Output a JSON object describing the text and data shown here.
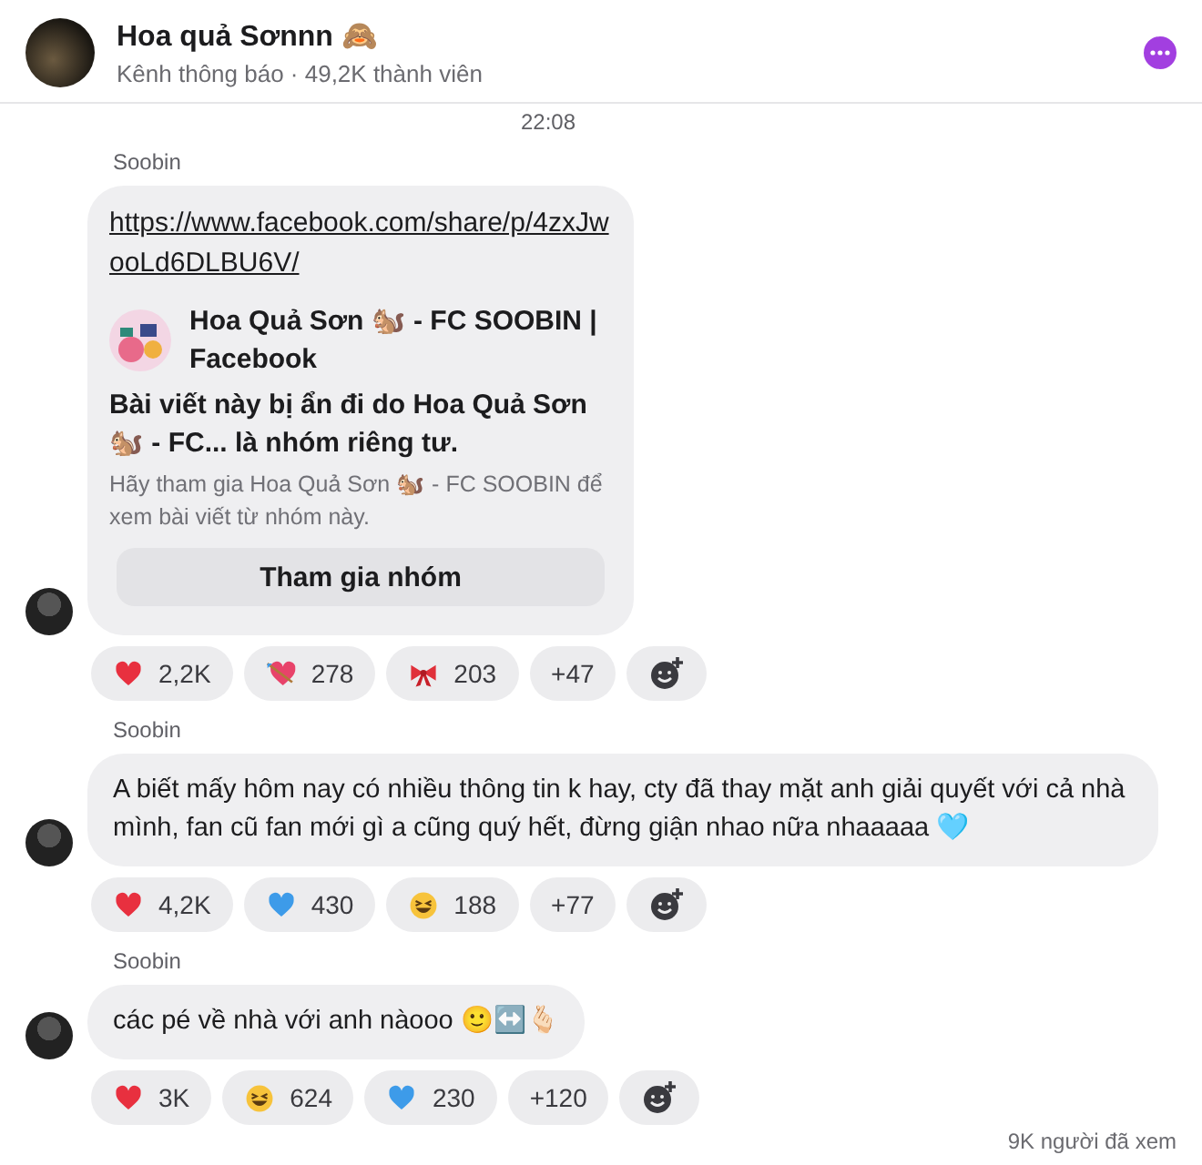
{
  "header": {
    "title": "Hoa quả Sơnnn 🙈",
    "subtitle": "Kênh thông báo · 49,2K thành viên"
  },
  "time": "22:08",
  "messages": [
    {
      "sender": "Soobin",
      "kind": "link",
      "link": "https://www.facebook.com/share/p/4zxJwooLd6DLBU6V/",
      "preview": {
        "title": "Hoa Quả Sơn 🐿️ - FC SOOBIN | Facebook",
        "headline": "Bài viết này bị ẩn đi do Hoa Quả Sơn 🐿️ - FC... là nhóm riêng tư.",
        "note": "Hãy tham gia Hoa Quả Sơn 🐿️ - FC SOOBIN để xem bài viết từ nhóm này.",
        "button": "Tham gia nhóm"
      },
      "reactions": [
        {
          "kind": "heart",
          "count": "2,2K"
        },
        {
          "kind": "cupid",
          "count": "278"
        },
        {
          "kind": "bow",
          "count": "203"
        },
        {
          "kind": "more",
          "count": "+47"
        },
        {
          "kind": "add"
        }
      ]
    },
    {
      "sender": "Soobin",
      "kind": "text",
      "text": "A biết mấy hôm nay có nhiều thông tin k hay, cty đã thay mặt anh giải quyết với cả nhà mình, fan cũ fan mới gì a cũng quý hết, đừng giận nhao nữa nhaaaaa 🩵",
      "reactions": [
        {
          "kind": "heart",
          "count": "4,2K"
        },
        {
          "kind": "blue-heart",
          "count": "430"
        },
        {
          "kind": "laugh",
          "count": "188"
        },
        {
          "kind": "more",
          "count": "+77"
        },
        {
          "kind": "add"
        }
      ]
    },
    {
      "sender": "Soobin",
      "kind": "text",
      "text": "các pé về nhà với anh nàooo 🙂↔️🫰🏻",
      "reactions": [
        {
          "kind": "heart",
          "count": "3K"
        },
        {
          "kind": "laugh",
          "count": "624"
        },
        {
          "kind": "blue-heart",
          "count": "230"
        },
        {
          "kind": "more",
          "count": "+120"
        },
        {
          "kind": "add"
        }
      ]
    }
  ],
  "footer": "9K người đã xem"
}
